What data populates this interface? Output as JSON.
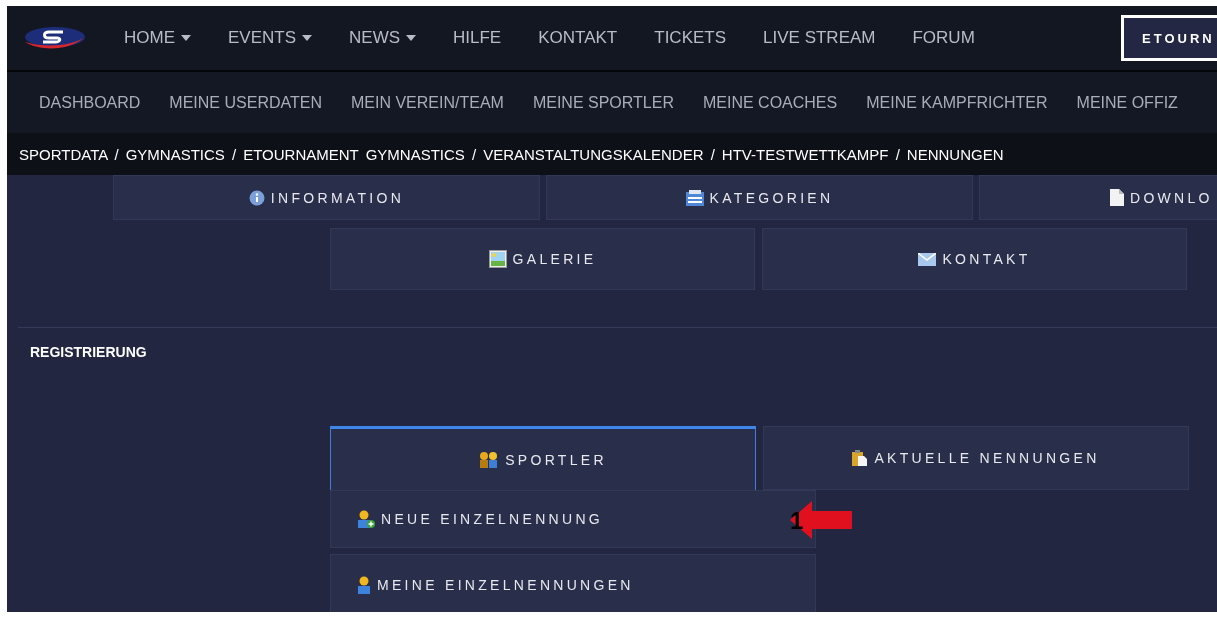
{
  "top_nav": {
    "items": [
      {
        "label": "HOME",
        "has_caret": true
      },
      {
        "label": "EVENTS",
        "has_caret": true
      },
      {
        "label": "NEWS",
        "has_caret": true
      },
      {
        "label": "HILFE",
        "has_caret": false
      },
      {
        "label": "KONTAKT",
        "has_caret": false
      },
      {
        "label": "TICKETS",
        "has_caret": false
      },
      {
        "label": "LIVE STREAM",
        "has_caret": false
      },
      {
        "label": "FORUM",
        "has_caret": false
      }
    ],
    "button": "ETOURN"
  },
  "sub_nav": [
    "DASHBOARD",
    "MEINE USERDATEN",
    "MEIN VEREIN/TEAM",
    "MEINE SPORTLER",
    "MEINE COACHES",
    "MEINE KAMPFRICHTER",
    "MEINE OFFIZ"
  ],
  "breadcrumb": [
    "SPORTDATA /",
    "GYMNASTICS /",
    "ETOURNAMENT GYMNASTICS /",
    "VERANSTALTUNGSKALENDER /",
    "HTV-TESTWETTKAMPF /",
    "NENNUNGEN"
  ],
  "tile_rows": [
    [
      {
        "label": "INFORMATION",
        "kind": "info"
      },
      {
        "label": "KATEGORIEN",
        "kind": "categories"
      },
      {
        "label": "DOWNLO",
        "kind": "document"
      }
    ],
    [
      {
        "label": "GALERIE",
        "kind": "gallery"
      },
      {
        "label": "KONTAKT",
        "kind": "mail"
      }
    ]
  ],
  "section_title": "REGISTRIERUNG",
  "tabs": [
    {
      "label": "SPORTLER",
      "kind": "people",
      "selected": true
    },
    {
      "label": "AKTUELLE NENNUNGEN",
      "kind": "clipboard",
      "selected": false
    }
  ],
  "dropdown": [
    {
      "label": "NEUE EINZELNENNUNG",
      "kind": "person-add"
    },
    {
      "label": "MEINE EINZELNENNUNGEN",
      "kind": "person"
    }
  ],
  "annotation": {
    "number": "1"
  }
}
